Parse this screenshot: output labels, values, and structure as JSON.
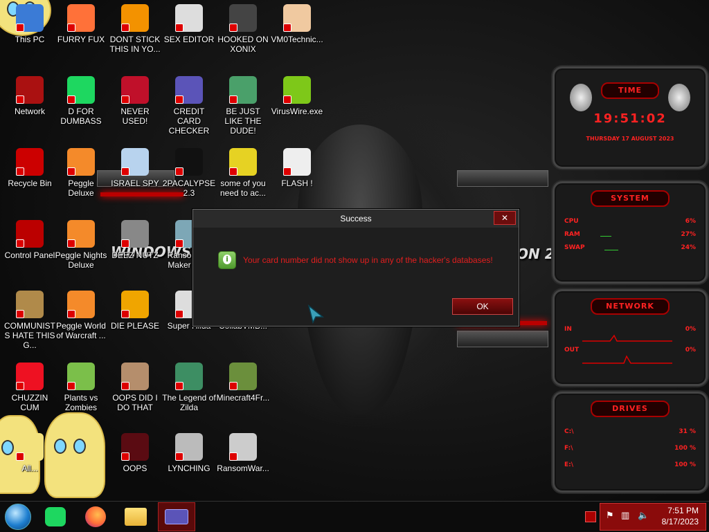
{
  "desktop_icons": [
    {
      "label": "This PC",
      "icon": "this-pc-icon"
    },
    {
      "label": "FURRY FUX",
      "icon": "firefox-icon"
    },
    {
      "label": "DONT STICK THIS IN YO...",
      "icon": "vlc-cone-icon"
    },
    {
      "label": "SEX EDITOR",
      "icon": "hex-editor-icon"
    },
    {
      "label": "HOOKED ON XONIX",
      "icon": "xonix-icon"
    },
    {
      "label": "VM0Technic...",
      "icon": "doctor-icon"
    },
    {
      "label": "Network",
      "icon": "network-icon"
    },
    {
      "label": "D FOR DUMBASS",
      "icon": "spotify-icon"
    },
    {
      "label": "NEVER USED!",
      "icon": "devcpp-icon"
    },
    {
      "label": "CREDIT CARD CHECKER",
      "icon": "credit-card-icon"
    },
    {
      "label": "BE JUST LIKE THE DUDE!",
      "icon": "santa-icon"
    },
    {
      "label": "VirusWire.exe",
      "icon": "lime-icon"
    },
    {
      "label": "Recycle Bin",
      "icon": "recycle-bin-icon"
    },
    {
      "label": "Peggle Deluxe",
      "icon": "peggle-icon"
    },
    {
      "label": "ISRAEL SPY",
      "icon": "spy-icon"
    },
    {
      "label": "2PACALYPSE 2.3",
      "icon": "terminal-icon"
    },
    {
      "label": "some of you need to ac...",
      "icon": "beaver-icon"
    },
    {
      "label": "FLASH !",
      "icon": "flash-icon"
    },
    {
      "label": "Control Panel",
      "icon": "control-panel-icon"
    },
    {
      "label": "Peggle Nights Deluxe",
      "icon": "peggle-icon"
    },
    {
      "label": "DEEZ NUTZ",
      "icon": "windows-stack-icon"
    },
    {
      "label": "Ransomw... Maker Bu...",
      "icon": "ransom-icon"
    },
    {
      "label": "COMMUNISTS HATE THIS G...",
      "icon": "money-bag-icon"
    },
    {
      "label": "Peggle World of Warcraft ...",
      "icon": "peggle-icon"
    },
    {
      "label": "DIE PLEASE",
      "icon": "adobe-de-icon"
    },
    {
      "label": "Super Hilda",
      "icon": "pixel-char-icon"
    },
    {
      "label": "CollabVMB...",
      "icon": "collabvm-icon"
    },
    {
      "label": "CHUZZIN CUM",
      "icon": "chuzzle-icon"
    },
    {
      "label": "Plants vs Zombies",
      "icon": "pvz-icon"
    },
    {
      "label": "OOPS DID I DO THAT",
      "icon": "portrait-icon"
    },
    {
      "label": "The Legend of Zilda",
      "icon": "zelda-icon"
    },
    {
      "label": "Minecraft4Fr...",
      "icon": "minecraft-icon"
    },
    {
      "label": "All...",
      "icon": "star-char-icon"
    },
    {
      "label": "OOPS",
      "icon": "monitor-icon"
    },
    {
      "label": "LYNCHING",
      "icon": "lynching-icon"
    },
    {
      "label": "RansomWar...",
      "icon": "skull-icon"
    }
  ],
  "wallpaper": {
    "text_left": "WINDOWS 8.1",
    "text_right": "ON 20"
  },
  "dialog": {
    "title": "Success",
    "message": "Your card number did not show up in any of the hacker's databases!",
    "ok_label": "OK",
    "close_label": "✕"
  },
  "gadgets": {
    "time": {
      "title": "TIME",
      "clock": "19:51:02",
      "date": "THURSDAY 17 AUGUST 2023"
    },
    "system": {
      "title": "SYSTEM",
      "rows": [
        {
          "label": "CPU",
          "value": "6%"
        },
        {
          "label": "RAM",
          "value": "27%"
        },
        {
          "label": "SWAP",
          "value": "24%"
        }
      ]
    },
    "network": {
      "title": "NETWORK",
      "rows": [
        {
          "label": "IN",
          "value": "0%"
        },
        {
          "label": "OUT",
          "value": "0%"
        }
      ]
    },
    "drives": {
      "title": "DRIVES",
      "rows": [
        {
          "label": "C:\\",
          "value": "31 %"
        },
        {
          "label": "F:\\",
          "value": "100 %"
        },
        {
          "label": "E:\\",
          "value": "100 %"
        }
      ]
    }
  },
  "taskbar": {
    "items": [
      {
        "name": "start-button",
        "icon": "start-orb-icon"
      },
      {
        "name": "spotify-task",
        "icon": "spotify-icon"
      },
      {
        "name": "firefox-task",
        "icon": "firefox-icon"
      },
      {
        "name": "explorer-task",
        "icon": "folder-icon"
      },
      {
        "name": "credit-card-task",
        "icon": "credit-card-icon"
      }
    ],
    "time": "7:51 PM",
    "date": "8/17/2023"
  },
  "colors": {
    "accent_red": "#e41e1e",
    "tray_red": "#8a0b0b",
    "dialog_bg": "#1e1e1e"
  }
}
